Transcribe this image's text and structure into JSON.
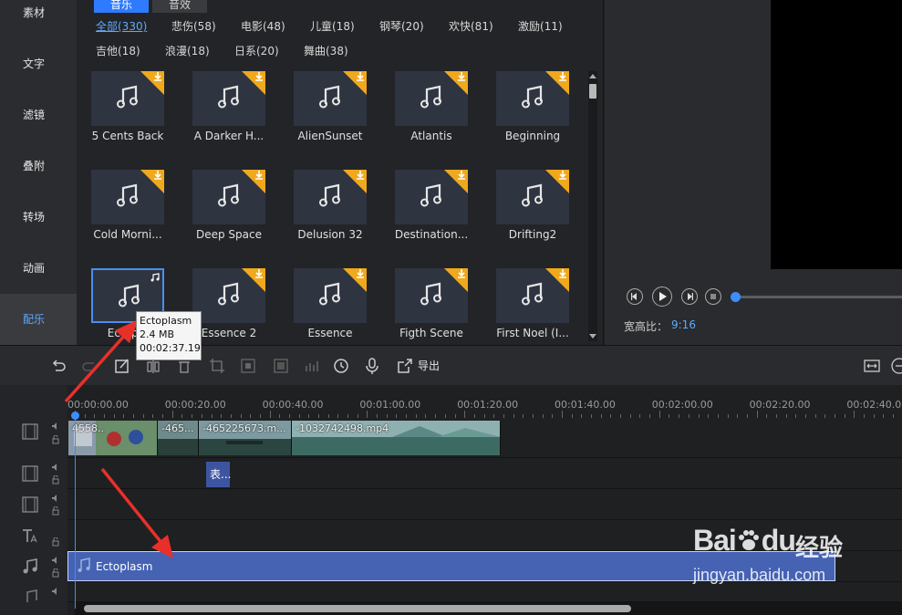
{
  "sidebar": {
    "items": [
      {
        "label": "素材"
      },
      {
        "label": "文字"
      },
      {
        "label": "滤镜"
      },
      {
        "label": "叠附"
      },
      {
        "label": "转场"
      },
      {
        "label": "动画"
      },
      {
        "label": "配乐"
      }
    ],
    "active_index": 6
  },
  "library": {
    "tabs": [
      {
        "label": "音乐"
      },
      {
        "label": "音效"
      }
    ],
    "categories": [
      {
        "label": "全部(330)"
      },
      {
        "label": "悲伤(58)"
      },
      {
        "label": "电影(48)"
      },
      {
        "label": "儿童(18)"
      },
      {
        "label": "钢琴(20)"
      },
      {
        "label": "欢快(81)"
      },
      {
        "label": "激励(11)"
      },
      {
        "label": "吉他(18)"
      },
      {
        "label": "浪漫(18)"
      },
      {
        "label": "日系(20)"
      },
      {
        "label": "舞曲(38)"
      }
    ],
    "tracks": [
      {
        "name": "5 Cents Back"
      },
      {
        "name": "A Darker H..."
      },
      {
        "name": "AlienSunset"
      },
      {
        "name": "Atlantis"
      },
      {
        "name": "Beginning"
      },
      {
        "name": "Cold Morni..."
      },
      {
        "name": "Deep Space"
      },
      {
        "name": "Delusion 32"
      },
      {
        "name": "Destination..."
      },
      {
        "name": "Drifting2"
      },
      {
        "name": "Ectopla"
      },
      {
        "name": "Essence 2"
      },
      {
        "name": "Essence"
      },
      {
        "name": "Figth Scene"
      },
      {
        "name": "First Noel (I..."
      }
    ],
    "selected_index": 10,
    "accent_color": "#2f7bff",
    "download_badge_color": "#f0a81c"
  },
  "tooltip": {
    "name": "Ectoplasm",
    "size": "2.4 MB",
    "duration": "00:02:37.19"
  },
  "preview": {
    "aspect_label": "宽高比：",
    "aspect_value": "9:16",
    "progress": 0.0
  },
  "toolbar": {
    "export_label": "导出"
  },
  "timeline": {
    "ruler": [
      "00:00:00.00",
      "00:00:20.00",
      "00:00:40.00",
      "00:01:00.00",
      "00:01:20.00",
      "00:01:40.00",
      "00:02:00.00",
      "00:02:20.00",
      "00:02:40.00"
    ],
    "video_clips": [
      {
        "label": "4558.."
      },
      {
        "label": "-465..."
      },
      {
        "label": "-465225673.m..."
      },
      {
        "label": "-1032742498.mp4"
      }
    ],
    "text_clip": "表...",
    "audio_clip": "Ectoplasm"
  },
  "watermark": {
    "brand": "Bai",
    "brand2": "du",
    "cn": "经验",
    "url": "jingyan.baidu.com"
  }
}
